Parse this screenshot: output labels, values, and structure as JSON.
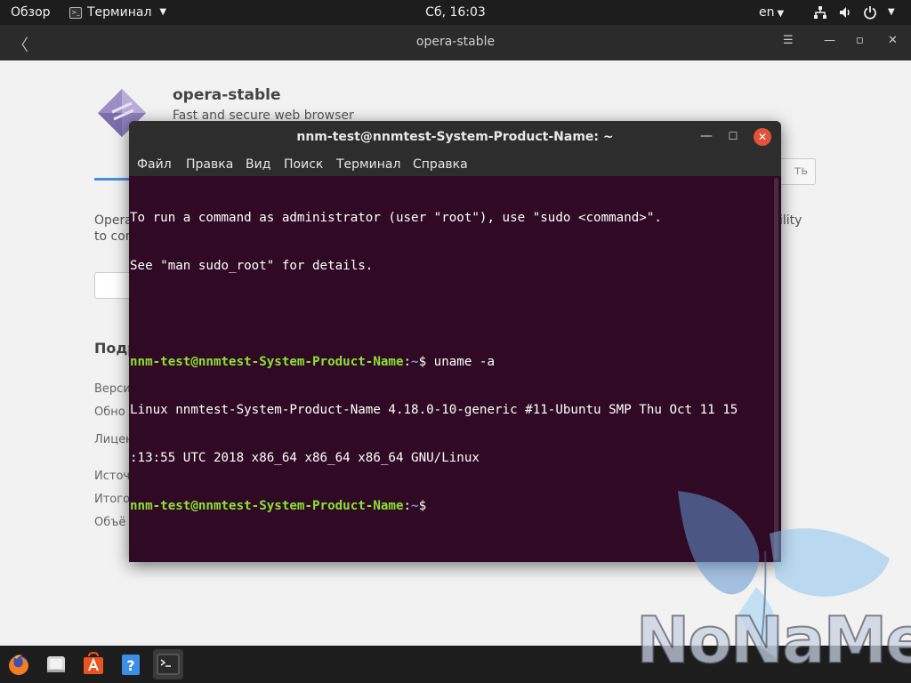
{
  "topbar": {
    "overview": "Обзор",
    "app_menu": "Терминал",
    "clock": "Сб, 16:03",
    "lang": "en"
  },
  "software_window": {
    "title": "opera-stable",
    "app_name": "opera-stable",
    "app_summary": "Fast and secure web browser",
    "install_button_fragment": "ть",
    "desc_line1_start": "Opera",
    "desc_line2_start": "to cor",
    "desc_line1_end": "ility",
    "details_heading": "Подр",
    "details": [
      "Верси",
      "Обно",
      "Лицен",
      "Источ",
      "Итого",
      "Объё"
    ]
  },
  "terminal": {
    "title": "nnm-test@nnmtest-System-Product-Name: ~",
    "menu": [
      "Файл",
      "Правка",
      "Вид",
      "Поиск",
      "Терминал",
      "Справка"
    ],
    "lines": {
      "l1": "To run a command as administrator (user \"root\"), use \"sudo <command>\".",
      "l2": "See \"man sudo_root\" for details.",
      "prompt_user": "nnm-test@nnmtest-System-Product-Name",
      "prompt_sep": ":",
      "prompt_path": "~",
      "prompt_cmd": "$ uname -a",
      "prompt_end": "$",
      "out1": "Linux nnmtest-System-Product-Name 4.18.0-10-generic #11-Ubuntu SMP Thu Oct 11 15",
      "out2": ":13:55 UTC 2018 x86_64 x86_64 x86_64 GNU/Linux"
    }
  },
  "dock": {
    "items": [
      "firefox-icon",
      "files-icon",
      "software-icon",
      "help-icon",
      "terminal-icon"
    ]
  },
  "watermark": {
    "text": "NoNaMe"
  },
  "colors": {
    "terminal_bg": "#300a24",
    "prompt_user": "#8ae234",
    "prompt_path": "#729fcf",
    "close_button": "#e0533a",
    "topbar": "#1d1d1d"
  }
}
